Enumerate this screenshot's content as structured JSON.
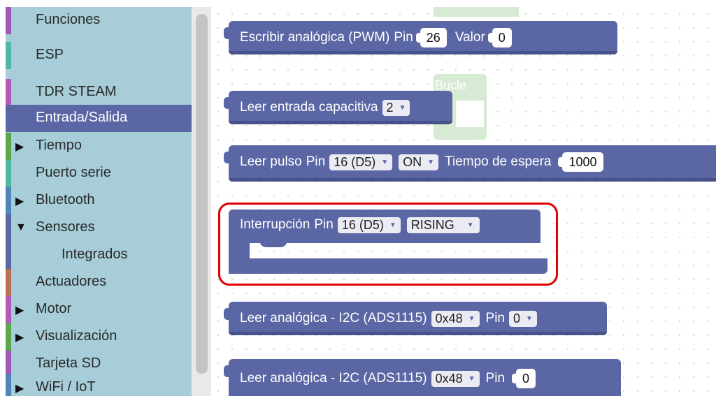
{
  "toolbox": {
    "categories": [
      {
        "label": "Funciones",
        "color": "#9f59b5",
        "arrow": ""
      },
      {
        "label": "ESP",
        "color": "#4eb8a5",
        "arrow": ""
      },
      {
        "label": "TDR STEAM",
        "color": "#b35ab8",
        "arrow": ""
      },
      {
        "label": "Entrada/Salida",
        "color": "#5b67a5",
        "arrow": "",
        "selected": true
      },
      {
        "label": "Tiempo",
        "color": "#5aa84e",
        "arrow": "▶"
      },
      {
        "label": "Puerto serie",
        "color": "#4eb89b",
        "arrow": ""
      },
      {
        "label": "Bluetooth",
        "color": "#4e86b8",
        "arrow": "▶"
      },
      {
        "label": "Sensores",
        "color": "#5b67a5",
        "arrow": "▼"
      },
      {
        "label": "Integrados",
        "color": "#5b67a5",
        "arrow": "",
        "sub": true
      },
      {
        "label": "Actuadores",
        "color": "#b87154",
        "arrow": ""
      },
      {
        "label": "Motor",
        "color": "#b35ab8",
        "arrow": "▶"
      },
      {
        "label": "Visualización",
        "color": "#5aa84e",
        "arrow": "▶"
      },
      {
        "label": "Tarjeta SD",
        "color": "#9f59b5",
        "arrow": ""
      },
      {
        "label": "WiFi / IoT",
        "color": "#4e86b8",
        "arrow": "▶"
      }
    ]
  },
  "workspace": {
    "ghost_label": "Bucle",
    "blocks": {
      "pwm": {
        "label": "Escribir analógica (PWM)",
        "pin_label": "Pin",
        "pin_value": "26",
        "value_label": "Valor",
        "value": "0"
      },
      "capacitive": {
        "label": "Leer entrada capacitiva",
        "option": "2"
      },
      "pulse": {
        "label": "Leer pulso",
        "pin_label": "Pin",
        "pin_option": "16 (D5)",
        "state_option": "ON",
        "timeout_label": "Tiempo de espera",
        "timeout_value": "1000"
      },
      "interrupt": {
        "label": "Interrupción",
        "pin_label": "Pin",
        "pin_option": "16 (D5)",
        "mode_option": "RISING"
      },
      "i2c_1": {
        "label": "Leer analógica - I2C (ADS1115)",
        "address_option": "0x48",
        "pin_label": "Pin",
        "pin_option": "0"
      },
      "i2c_2": {
        "label": "Leer analógica - I2C (ADS1115)",
        "address_option": "0x48",
        "pin_label": "Pin",
        "pin_value": "0"
      }
    }
  },
  "colors": {
    "io_block": "#5b67a5",
    "toolbox_bg": "#a6cdd8",
    "highlight": "#e00000"
  }
}
